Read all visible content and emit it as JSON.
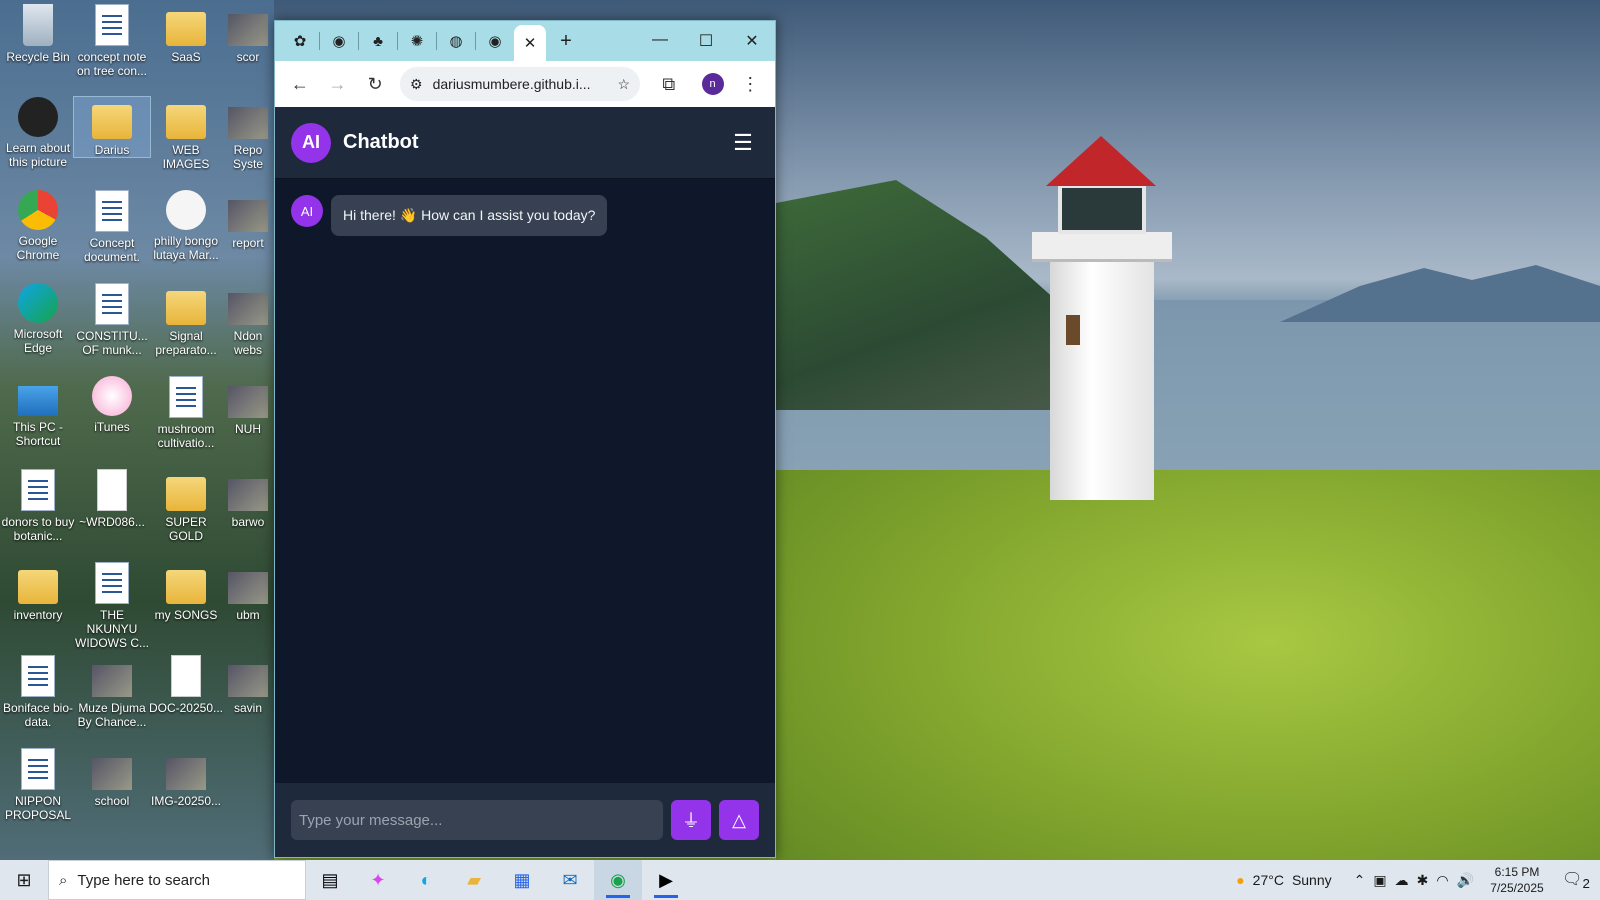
{
  "desktop": {
    "icons": [
      {
        "label": "Recycle Bin",
        "icon": "recycle-bin-icon"
      },
      {
        "label": "concept note on tree con...",
        "icon": "word-doc-icon"
      },
      {
        "label": "SaaS",
        "icon": "folder-icon"
      },
      {
        "label": "scor",
        "icon": "thumbnail-icon"
      },
      {
        "label": "Learn about this picture",
        "icon": "info-icon"
      },
      {
        "label": "Darius",
        "icon": "folder-icon"
      },
      {
        "label": "WEB IMAGES",
        "icon": "folder-icon"
      },
      {
        "label": "Repo Syste",
        "icon": "thumbnail-icon"
      },
      {
        "label": "Google Chrome",
        "icon": "chrome-icon"
      },
      {
        "label": "Concept document.",
        "icon": "word-doc-icon"
      },
      {
        "label": "philly bongo lutaya Mar...",
        "icon": "media-icon"
      },
      {
        "label": "report",
        "icon": "thumbnail-icon"
      },
      {
        "label": "Microsoft Edge",
        "icon": "edge-icon"
      },
      {
        "label": "CONSTITU... OF munk...",
        "icon": "word-doc-icon"
      },
      {
        "label": "Signal preparato...",
        "icon": "folder-icon"
      },
      {
        "label": "Ndon webs",
        "icon": "thumbnail-icon"
      },
      {
        "label": "This PC - Shortcut",
        "icon": "pc-icon"
      },
      {
        "label": "iTunes",
        "icon": "itunes-icon"
      },
      {
        "label": "mushroom cultivatio...",
        "icon": "word-doc-icon"
      },
      {
        "label": "NUH",
        "icon": "thumbnail-icon"
      },
      {
        "label": "donors to buy botanic...",
        "icon": "word-doc-icon"
      },
      {
        "label": "~WRD086...",
        "icon": "blank-file-icon"
      },
      {
        "label": "SUPER GOLD",
        "icon": "folder-icon"
      },
      {
        "label": "barwo",
        "icon": "thumbnail-icon"
      },
      {
        "label": "inventory",
        "icon": "folder-icon"
      },
      {
        "label": "THE NKUNYU WIDOWS C...",
        "icon": "word-doc-icon"
      },
      {
        "label": "my SONGS",
        "icon": "folder-icon"
      },
      {
        "label": "ubm",
        "icon": "thumbnail-icon"
      },
      {
        "label": "Boniface bio-data.",
        "icon": "word-doc-icon"
      },
      {
        "label": "Muze Djuma By Chance...",
        "icon": "image-icon"
      },
      {
        "label": "DOC-20250...",
        "icon": "blank-file-icon"
      },
      {
        "label": "savin",
        "icon": "thumbnail-icon"
      },
      {
        "label": "NIPPON PROPOSAL",
        "icon": "word-doc-icon"
      },
      {
        "label": "school",
        "icon": "image-icon"
      },
      {
        "label": "IMG-20250...",
        "icon": "image-icon"
      }
    ]
  },
  "browser": {
    "tabs": [
      {
        "icon": "tab-favicon-icon",
        "glyph": "✿"
      },
      {
        "icon": "github-icon",
        "glyph": "◉"
      },
      {
        "icon": "app-favicon-icon",
        "glyph": "♣"
      },
      {
        "icon": "openai-icon",
        "glyph": "✺"
      },
      {
        "icon": "globe-icon",
        "glyph": "◍"
      },
      {
        "icon": "github-icon",
        "glyph": "◉"
      }
    ],
    "active_tab_close": "✕",
    "new_tab": "+",
    "window_controls": {
      "minimize": "—",
      "maximize": "☐",
      "close": "✕"
    },
    "url": "dariusmumbere.github.i...",
    "profile_initial": "n"
  },
  "chat": {
    "avatar_label": "AI",
    "title": "Chatbot",
    "messages": [
      {
        "sender": "AI",
        "text": "Hi there! 👋 How can I assist you today?"
      }
    ],
    "input_placeholder": "Type your message...",
    "accent_color": "#9333ea"
  },
  "taskbar": {
    "search_placeholder": "Type here to search",
    "weather": {
      "temp": "27°C",
      "condition": "Sunny"
    },
    "time": "6:15 PM",
    "date": "7/25/2025",
    "notification_count": "2"
  }
}
